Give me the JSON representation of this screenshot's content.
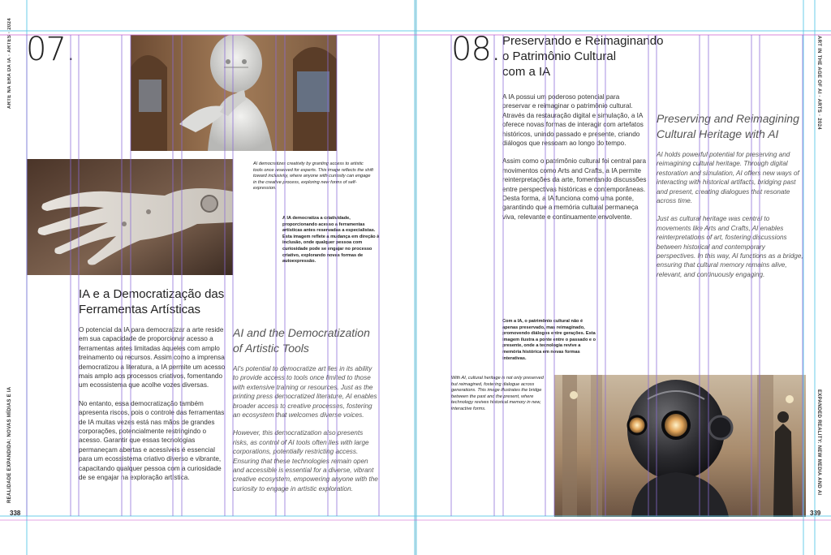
{
  "left_page": {
    "number": "07.",
    "side_top": "ARTE NA ERA DA IA · ARTES · 2024",
    "side_bottom": "REALIDADE EXPANDIDA: NOVAS MÍDIAS E IA",
    "folio": "338",
    "heading_pt": [
      "IA e a Democratização das",
      "Ferramentas Artísticas"
    ],
    "body_pt": [
      "O potencial da IA para democratizar a arte reside em sua capacidade de proporcionar acesso a ferramentas antes limitadas àqueles com amplo treinamento ou recursos. Assim como a imprensa democratizou a literatura, a IA permite um acesso mais amplo aos processos criativos, fomentando um ecossistema que acolhe vozes diversas.",
      "No entanto, essa democratização também apresenta riscos, pois o controle das ferramentas de IA muitas vezes está nas mãos de grandes corporações, potencialmente restringindo o acesso. Garantir que essas tecnologias permaneçam abertas e acessíveis é essencial para um ecossistema criativo diverso e vibrante, capacitando qualquer pessoa com a curiosidade de se engajar na exploração artística."
    ],
    "heading_en": [
      "AI and the Democratization",
      "of Artistic Tools"
    ],
    "body_en": [
      "AI's potential to democratize art lies in its ability to provide access to tools once limited to those with extensive training or resources. Just as the printing press democratized literature, AI enables broader access to creative processes, fostering an ecosystem that welcomes diverse voices.",
      "However, this democratization also presents risks, as control of AI tools often lies with large corporations, potentially restricting access. Ensuring that these technologies remain open and accessible is essential for a diverse, vibrant creative ecosystem, empowering anyone with the curiosity to engage in artistic exploration."
    ],
    "caption_en": "AI democratizes creativity by granting access to artistic tools once reserved for experts. This image reflects the shift toward inclusivity, where anyone with curiosity can engage in the creative process, exploring new forms of self-expression.",
    "caption_pt": "A IA democratiza a criatividade, proporcionando acesso a ferramentas artísticas antes reservadas a especialistas. Esta imagem reflete a mudança em direção à inclusão, onde qualquer pessoa com curiosidade pode se engajar no processo criativo, explorando novas formas de autoexpressão."
  },
  "right_page": {
    "number": "08.",
    "side_top": "ART IN THE AGE OF AI · ARTS · 2024",
    "side_bottom": "EXPANDED REALITY: NEW MEDIA AND AI",
    "folio": "339",
    "heading_pt": [
      "Preservando e Reimaginando",
      "o Patrimônio Cultural",
      "com a IA"
    ],
    "body_pt": [
      "A IA possui um poderoso potencial para preservar e reimaginar o patrimônio cultural. Através da restauração digital e simulação, a IA oferece novas formas de interagir com artefatos históricos, unindo passado e presente, criando diálogos que ressoam ao longo do tempo.",
      "Assim como o patrimônio cultural foi central para movimentos como Arts and Crafts, a IA permite reinterpretações da arte, fomentando discussões entre perspectivas históricas e contemporâneas. Desta forma, a IA funciona como uma ponte, garantindo que a memória cultural permaneça viva, relevante e continuamente envolvente."
    ],
    "heading_en": [
      "Preserving and Reimagining",
      "Cultural Heritage with AI"
    ],
    "body_en": [
      "AI holds powerful potential for preserving and reimagining cultural heritage. Through digital restoration and simulation, AI offers new ways of interacting with historical artifacts, bridging past and present, creating dialogues that resonate across time.",
      "Just as cultural heritage was central to movements like Arts and Crafts, AI enables reinterpretations of art, fostering discussions between historical and contemporary perspectives. In this way, AI functions as a bridge, ensuring that cultural memory remains alive, relevant, and continuously engaging."
    ],
    "caption_pt": "Com a IA, o patrimônio cultural não é apenas preservado, mas reimaginado, promovendo diálogos entre gerações. Esta imagem ilustra a ponte entre o passado e o presente, onde a tecnologia revive a memória histórica em novas formas interativas.",
    "caption_en": "With AI, cultural heritage is not only preserved but reimagined, fostering dialogue across generations. This image illustrates the bridge between the past and the present, where technology revives historical memory in new, interactive forms."
  },
  "colors": {
    "guide_cyan": "#5bc8e6",
    "guide_magenta": "#d26ad2",
    "guide_purple": "#8a6ad6",
    "text_dark": "#222222",
    "text_italic": "#555555"
  }
}
